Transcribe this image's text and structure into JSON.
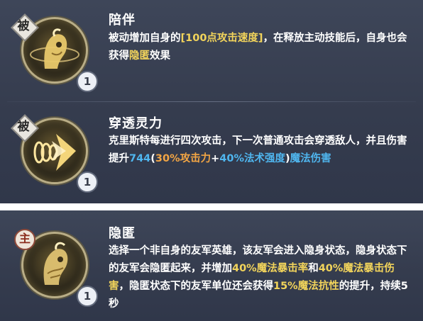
{
  "skills": [
    {
      "tag": "被",
      "level": "1",
      "name": "陪伴",
      "icon": "companion-spirit-icon",
      "desc": {
        "p1": "被动增加自身的",
        "bracket_open": "[",
        "h1": "100点攻击速度",
        "bracket_close": "]",
        "p2": "，在释放主动技能后，自身也会获得",
        "h2": "隐匿",
        "p3": "效果"
      }
    },
    {
      "tag": "被",
      "level": "1",
      "name": "穿透灵力",
      "icon": "piercing-arrow-icon",
      "desc": {
        "p1": "克里斯特每进行四次攻击，下一次普通攻击会穿透敌人，并且伤害提升",
        "n1": "744",
        "p2": "(",
        "h1": "30%攻击力",
        "p3": "+",
        "h2": "40%法术强度",
        "p4": ")",
        "h3": "魔法伤害"
      }
    },
    {
      "tag": "主",
      "level": "1",
      "name": "隐匿",
      "icon": "stealth-spirit-icon",
      "desc": {
        "p1": "选择一个非自身的友军英雄，该友军会进入隐身状态，隐身状态下的友军会隐匿起来，并增加",
        "h1": "40%魔法暴击率",
        "p2": "和",
        "h2": "40%魔法暴击伤害",
        "p3": "，隐匿状态下的友军单位还会获得",
        "h3": "15%魔法抗性",
        "p4": "的提升，持续5秒"
      }
    }
  ]
}
